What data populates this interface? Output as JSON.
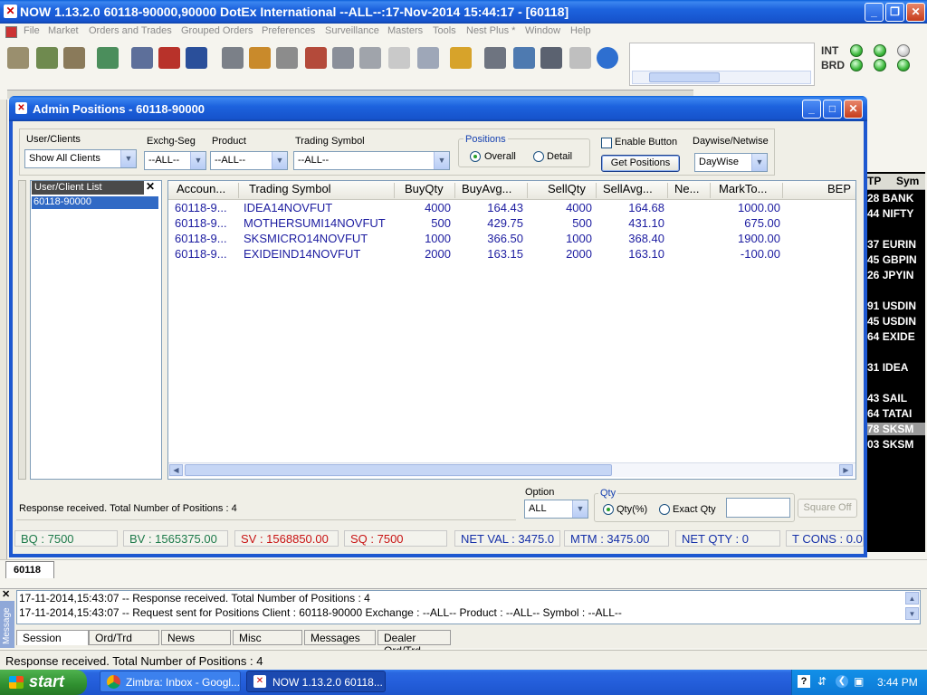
{
  "main_window": {
    "title": "NOW 1.13.2.0 60118-90000,90000 DotEx International --ALL--:17-Nov-2014 15:44:17 - [60118]"
  },
  "menu": [
    "File",
    "Market",
    "Orders and Trades",
    "Grouped Orders",
    "Preferences",
    "Surveillance",
    "Masters",
    "Tools",
    "Nest Plus *",
    "Window",
    "Help"
  ],
  "indicators": {
    "int_label": "INT",
    "brd_label": "BRD"
  },
  "dialog": {
    "title": "Admin Positions - 60118-90000",
    "user_clients_label": "User/Clients",
    "user_clients_value": "Show All Clients",
    "exchg_seg_label": "Exchg-Seg",
    "exchg_seg_value": "--ALL--",
    "product_label": "Product",
    "product_value": "--ALL--",
    "trading_symbol_label": "Trading Symbol",
    "trading_symbol_value": "--ALL--",
    "positions_label": "Positions",
    "overall_label": "Overall",
    "detail_label": "Detail",
    "enable_button_label": "Enable Button",
    "get_positions_label": "Get Positions",
    "daywise_label": "Daywise/Netwise",
    "daywise_value": "DayWise",
    "user_list_header": "User/Client List",
    "user_list_items": [
      "60118-90000"
    ],
    "close_glyph": "✕",
    "grid": {
      "headers": [
        "Accoun...",
        "Trading Symbol",
        "BuyQty",
        "BuyAvg...",
        "SellQty",
        "SellAvg...",
        "Ne...",
        "MarkTo...",
        "BEP"
      ],
      "rows": [
        [
          "60118-9...",
          "IDEA14NOVFUT",
          "4000",
          "164.43",
          "4000",
          "164.68",
          "",
          "1000.00",
          ""
        ],
        [
          "60118-9...",
          "MOTHERSUMI14NOVFUT",
          "500",
          "429.75",
          "500",
          "431.10",
          "",
          "675.00",
          ""
        ],
        [
          "60118-9...",
          "SKSMICRO14NOVFUT",
          "1000",
          "366.50",
          "1000",
          "368.40",
          "",
          "1900.00",
          ""
        ],
        [
          "60118-9...",
          "EXIDEIND14NOVFUT",
          "2000",
          "163.15",
          "2000",
          "163.10",
          "",
          "-100.00",
          ""
        ]
      ]
    },
    "response_text": "Response received. Total Number of Positions : 4",
    "option_label": "Option",
    "option_value": "ALL",
    "qty_label": "Qty",
    "qty_pct_label": "Qty(%)",
    "exact_qty_label": "Exact Qty",
    "square_off_label": "Square Off",
    "stats": {
      "bq": "BQ : 7500",
      "bv": "BV : 1565375.00",
      "sv": "SV : 1568850.00",
      "sq": "SQ : 7500",
      "net_val": "NET VAL : 3475.0",
      "mtm": "MTM : 3475.00",
      "net_qty": "NET QTY : 0",
      "t_cons": "T CONS : 0.0"
    }
  },
  "right_panel": {
    "header_a": "TP",
    "header_b": "Sym",
    "rows": [
      {
        "a": "28",
        "b": "BANK"
      },
      {
        "a": "44",
        "b": "NIFTY"
      },
      {
        "a": "37",
        "b": "EURIN"
      },
      {
        "a": "45",
        "b": "GBPIN"
      },
      {
        "a": "26",
        "b": "JPYIN"
      },
      {
        "a": "91",
        "b": "USDIN"
      },
      {
        "a": "45",
        "b": "USDIN"
      },
      {
        "a": "64",
        "b": "EXIDE"
      },
      {
        "a": "31",
        "b": "IDEA"
      },
      {
        "a": "43",
        "b": "SAIL"
      },
      {
        "a": "64",
        "b": "TATAI"
      },
      {
        "a": "78",
        "b": "SKSM"
      },
      {
        "a": "03",
        "b": "SKSM"
      }
    ]
  },
  "doc_tab": "60118",
  "message_log": {
    "side_label": "Message",
    "lines": [
      "17-11-2014,15:43:07  -- Response received. Total Number of Positions : 4",
      "17-11-2014,15:43:07  -- Request sent for Positions  Client : 60118-90000 Exchange : --ALL-- Product : --ALL-- Symbol : --ALL--"
    ]
  },
  "bottom_tabs": [
    "Session",
    "Ord/Trd",
    "News",
    "Misc",
    "Messages",
    "Dealer Ord/Trd"
  ],
  "status_bar": "Response received. Total Number of Positions : 4",
  "taskbar": {
    "start_label": "start",
    "task1": "Zimbra: Inbox - Googl...",
    "task2": "NOW 1.13.2.0 60118...",
    "clock": "3:44 PM"
  }
}
